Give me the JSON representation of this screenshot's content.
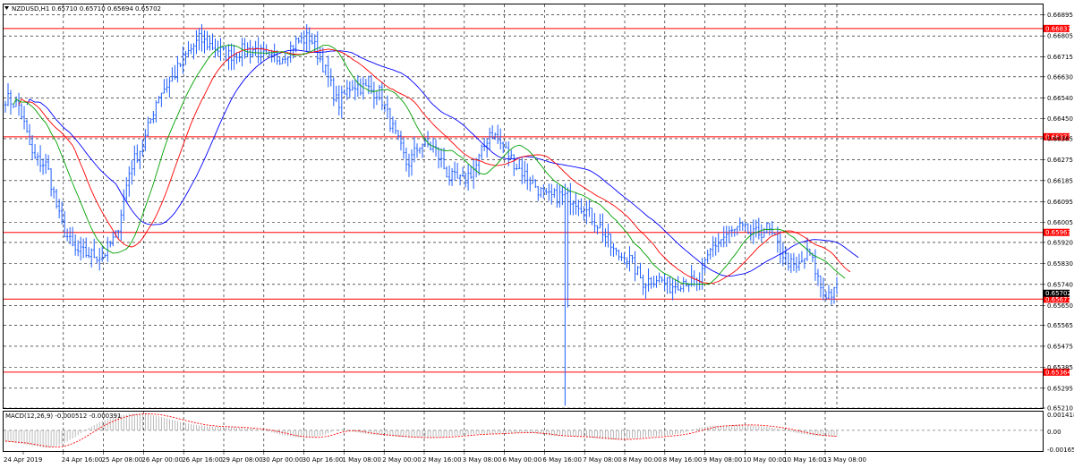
{
  "window": {
    "title": "NZDUSD,H1  0.65710 0.65710 0.65694 0.65702",
    "dropdown_icon": "triangle-down-icon"
  },
  "macd_panel": {
    "title": "MACD(12,26,9) -0.000512 -0.000391",
    "y_labels": [
      "0.001418",
      "0.00",
      "-0.001651"
    ]
  },
  "chart_data": {
    "type": "bar",
    "symbol": "NZDUSD",
    "timeframe": "H1",
    "x_tick_labels": [
      "24 Apr 2019",
      "24 Apr 16:00",
      "25 Apr 08:00",
      "26 Apr 00:00",
      "26 Apr 16:00",
      "29 Apr 08:00",
      "30 Apr 00:00",
      "30 Apr 16:00",
      "1 May 08:00",
      "2 May 00:00",
      "2 May 16:00",
      "3 May 08:00",
      "6 May 00:00",
      "6 May 16:00",
      "7 May 08:00",
      "8 May 00:00",
      "8 May 16:00",
      "9 May 08:00",
      "10 May 00:00",
      "10 May 16:00",
      "13 May 08:00"
    ],
    "y_tick_labels": [
      "0.66895",
      "0.66805",
      "0.66715",
      "0.66630",
      "0.66540",
      "0.66450",
      "0.66365",
      "0.66275",
      "0.66185",
      "0.66095",
      "0.66005",
      "0.65920",
      "0.65830",
      "0.65740",
      "0.65650",
      "0.65565",
      "0.65475",
      "0.65385",
      "0.65295",
      "0.65210"
    ],
    "ylim": [
      0.6521,
      0.6694
    ],
    "levels": [
      {
        "value": 0.66837,
        "label": "0.66837"
      },
      {
        "value": 0.66373,
        "label": "0.66373"
      },
      {
        "value": 0.65963,
        "label": "0.65963"
      },
      {
        "value": 0.65677,
        "label": "0.65677"
      },
      {
        "value": 0.65364,
        "label": "0.65364"
      }
    ],
    "current_price": {
      "value": 0.65702,
      "label": "0.65702"
    },
    "price_anchors": [
      0.6654,
      0.66505,
      0.6628,
      0.6625,
      0.66,
      0.6588,
      0.6587,
      0.6586,
      0.6595,
      0.6624,
      0.6635,
      0.6655,
      0.6662,
      0.6672,
      0.6679,
      0.6676,
      0.6672,
      0.6674,
      0.6675,
      0.667,
      0.6672,
      0.6678,
      0.668,
      0.6667,
      0.6651,
      0.666,
      0.6658,
      0.6656,
      0.664,
      0.6625,
      0.6635,
      0.6632,
      0.662,
      0.6618,
      0.6625,
      0.664,
      0.6632,
      0.6624,
      0.6618,
      0.6611,
      0.6612,
      0.6611,
      0.6605,
      0.6598,
      0.6587,
      0.6585,
      0.6575,
      0.6577,
      0.6573,
      0.6576,
      0.6574,
      0.659,
      0.6595,
      0.6598,
      0.6595,
      0.6598,
      0.6588,
      0.658,
      0.6588,
      0.657,
      0.65702
    ],
    "ma_colors": {
      "fast": "#00a000",
      "mid": "#ff0000",
      "slow": "#0000ff"
    },
    "bar_color": "#1e5eff",
    "level_color": "#ff0000",
    "grid": true,
    "macd": {
      "ylim": [
        -0.001651,
        0.001418
      ],
      "histogram_anchors": [
        -0.0009,
        -0.0011,
        -0.0013,
        -0.0015,
        -0.0012,
        -0.0006,
        0.0002,
        0.0008,
        0.0012,
        0.0014,
        0.0014,
        0.0012,
        0.0009,
        0.0006,
        0.0004,
        0.0003,
        0.0003,
        0.0002,
        0.0001,
        -0.0001,
        -0.0004,
        -0.0006,
        -0.0006,
        -0.0004,
        0.0001,
        -0.0001,
        -0.0003,
        -0.0004,
        -0.0005,
        -0.0006,
        -0.0006,
        -0.0006,
        -0.0005,
        -0.0004,
        -0.0003,
        -0.0003,
        -0.0002,
        -0.0002,
        -0.0002,
        -0.0004,
        -0.0005,
        -0.0005,
        -0.0006,
        -0.0007,
        -0.0008,
        -0.0007,
        -0.0006,
        -0.0005,
        -0.0004,
        -0.0002,
        0.0002,
        0.0004,
        0.0004,
        0.0005,
        0.0004,
        0.0003,
        0.0001,
        -0.0002,
        -0.0004,
        -0.0005,
        -0.0005
      ],
      "signal_color": "#ff0000",
      "hist_color": "#a9a9a9"
    }
  }
}
